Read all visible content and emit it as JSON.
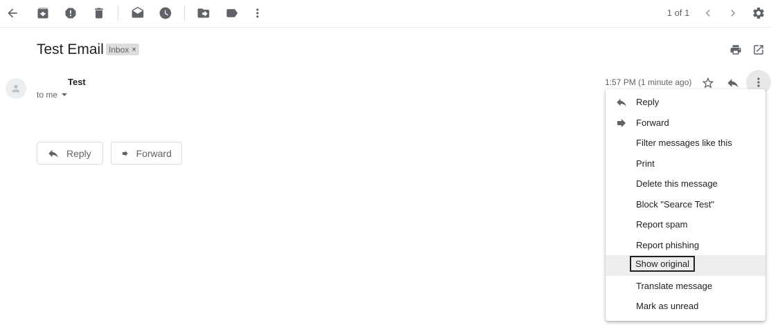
{
  "toolbar": {
    "pager_text": "1 of 1",
    "buttons": [
      "back-arrow-icon",
      "archive-icon",
      "report-spam-icon",
      "delete-icon",
      "mark-unread-icon",
      "snooze-icon",
      "move-to-icon",
      "label-icon",
      "more-vert-icon",
      "newer-chevron-icon",
      "older-chevron-icon",
      "settings-gear-icon"
    ]
  },
  "subject": {
    "title": "Test Email",
    "label": "Inbox",
    "label_remove": "×"
  },
  "message": {
    "sender": "Test",
    "recipient": "to me",
    "time": "1:57 PM (1 minute ago)"
  },
  "actions": {
    "reply": "Reply",
    "forward": "Forward"
  },
  "menu": {
    "items": [
      {
        "label": "Reply",
        "icon": "reply-icon"
      },
      {
        "label": "Forward",
        "icon": "forward-icon"
      },
      {
        "label": "Filter messages like this"
      },
      {
        "label": "Print"
      },
      {
        "label": "Delete this message"
      },
      {
        "label": "Block \"Searce Test\""
      },
      {
        "label": "Report spam"
      },
      {
        "label": "Report phishing"
      },
      {
        "label": "Show original",
        "highlighted": true
      },
      {
        "label": "Translate message"
      },
      {
        "label": "Mark as unread"
      }
    ]
  },
  "colors": {
    "icon": "#5f6368",
    "text": "#202124",
    "highlight": "#eeeeee",
    "label_chip": "#dddddd"
  }
}
